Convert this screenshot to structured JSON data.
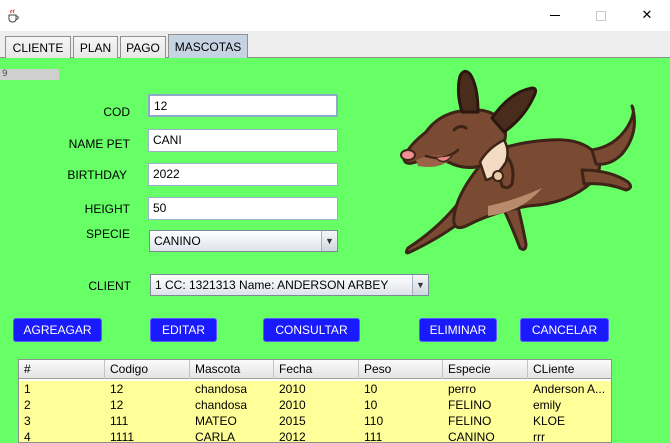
{
  "window": {
    "minimize_glyph": "",
    "maximize_glyph": "",
    "close_glyph": "✕"
  },
  "tabs": [
    {
      "label": "CLIENTE"
    },
    {
      "label": "PLAN"
    },
    {
      "label": "PAGO"
    },
    {
      "label": "MASCOTAS"
    }
  ],
  "form": {
    "id_value": "9",
    "cod_label": "COD",
    "cod_value": "12",
    "name_label": "NAME PET",
    "name_value": "CANI",
    "birthday_label": "BIRTHDAY",
    "birthday_value": "2022",
    "height_label": "HEIGHT",
    "height_value": "50",
    "specie_label": "SPECIE",
    "specie_value": "CANINO",
    "client_label": "CLIENT",
    "client_value": "1 CC: 1321313 Name: ANDERSON ARBEY"
  },
  "buttons": {
    "add": "AGREAGAR",
    "edit": "EDITAR",
    "query": "CONSULTAR",
    "delete": "ELIMINAR",
    "cancel": "CANCELAR"
  },
  "table": {
    "headers": [
      "#",
      "Codigo",
      "Mascota",
      "Fecha",
      "Peso",
      "Especie",
      "CLiente"
    ],
    "rows": [
      [
        "1",
        "12",
        "chandosa",
        "2010",
        "10",
        "perro",
        "Anderson A..."
      ],
      [
        "2",
        "12",
        "chandosa",
        "2010",
        "10",
        "FELINO",
        "emily"
      ],
      [
        "3",
        "111",
        "MATEO",
        "2015",
        "110",
        "FELINO",
        "KLOE"
      ],
      [
        "4",
        "1111",
        "CARLA",
        "2012",
        "111",
        "CANINO",
        "rrr"
      ]
    ]
  },
  "colors": {
    "panel_bg": "#66ff66",
    "button_bg": "#1a1aff",
    "row_bg": "#ffff99",
    "tab_active": "#c6d3e2"
  },
  "icons": {
    "app": "java-cup-icon",
    "illustration": "cartoon-dog-illustration",
    "dropdown": "triangle-down"
  }
}
